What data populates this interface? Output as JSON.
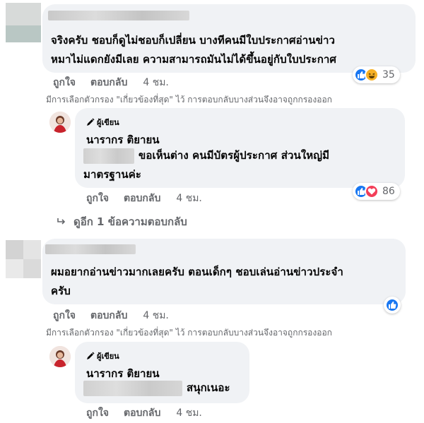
{
  "comments": [
    {
      "text_line1": "จริงครับ ชอบก็ดูไม่ชอบก็เปลี่ยน บางทีคนมีใบประกาศอ่านข่าว",
      "text_line2": "หมาไม่แดกยังมีเลย ความสามารถมันไม่ได้ขึ้นอยู่กับใบประกาศ",
      "like": "ถูกใจ",
      "reply": "ตอบกลับ",
      "time": "4 ชม.",
      "reaction_count": "35",
      "reaction_icons": [
        "like-icon",
        "haha-icon"
      ]
    },
    {
      "text_line1": "ผมอยากอ่านข่าวมากเลยครับ ตอนเด็กๆ ชอบเล่นอ่านข่าวประจำ",
      "text_line2": "ครับ",
      "like": "ถูกใจ",
      "reply": "ตอบกลับ",
      "time": "4 ชม.",
      "reaction_icons": [
        "like-icon"
      ]
    }
  ],
  "filter_note": "มีการเลือกตัวกรอง \"เกี่ยวข้องที่สุด\" ไว้ การตอบกลับบางส่วนจึงอาจถูกกรองออก",
  "replies": [
    {
      "badge": "ผู้เขียน",
      "author": "นารากร ติยายน",
      "text_line1": "ขอเห็นต่าง คนมีบัตรผู้ประกาศ ส่วนใหญ่มี",
      "text_line2": "มาตรฐานค่ะ",
      "like": "ถูกใจ",
      "reply": "ตอบกลับ",
      "time": "4 ชม.",
      "reaction_count": "86",
      "reaction_icons": [
        "like-icon",
        "love-icon"
      ]
    },
    {
      "badge": "ผู้เขียน",
      "author": "นารากร ติยายน",
      "text_line1": "สนุกเนอะ",
      "like": "ถูกใจ",
      "reply": "ตอบกลับ",
      "time": "4 ชม."
    }
  ],
  "more_replies": "ดูอีก 1 ข้อความตอบกลับ",
  "colors": {
    "bubble": "#f0f2f5",
    "meta": "#65676b",
    "like": "#1877f2",
    "love": "#f33e58",
    "haha": "#f7b125"
  }
}
